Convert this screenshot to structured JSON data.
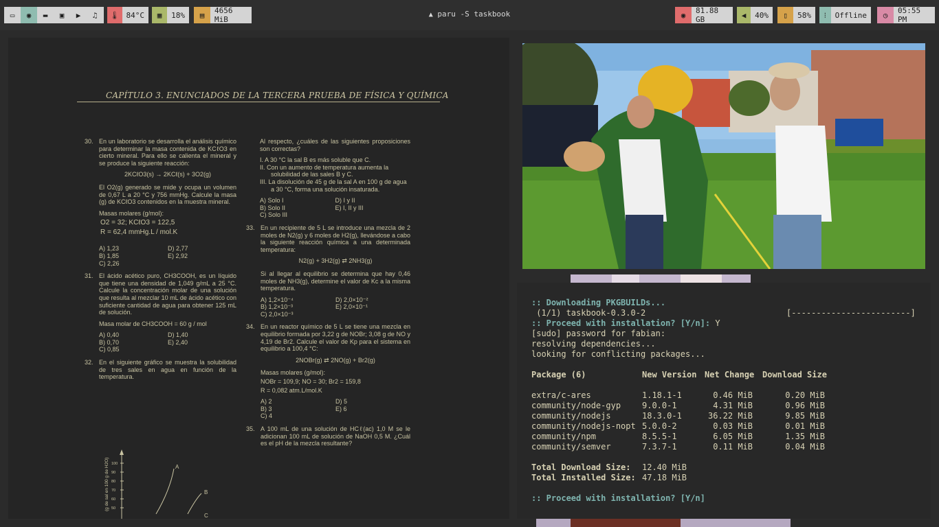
{
  "topbar": {
    "launcher_icons": [
      "terminal-icon",
      "browser-icon",
      "folder-icon",
      "monitor-icon",
      "youtube-icon",
      "music-icon"
    ],
    "temperature": "84°C",
    "cpu": "18%",
    "memory": "4656 MiB",
    "window_title": "paru -S taskbook",
    "disk": "81.88 GB",
    "volume": "40%",
    "battery": "58%",
    "network": "Offline",
    "clock": "05:55 PM",
    "colors": {
      "temp": "#e06c6c",
      "cpu": "#aab86a",
      "memory": "#d6a24a",
      "disk": "#e06c6c",
      "volume": "#aab86a",
      "battery": "#d6a24a",
      "network": "#8fbcb0",
      "clock": "#d98aa6"
    }
  },
  "pdf": {
    "chapter_header": "CAPÍTULO 3.  ENUNCIADOS DE LA TERCERA PRUEBA DE FÍSICA Y QUÍMICA",
    "q30": {
      "num": "30.",
      "text": "En un laboratorio se desarrolla el análisis químico para determinar la masa contenida de KCℓO3 en cierto mineral. Para ello se calienta el mineral y se produce la siguiente reacción:",
      "reaction": "2KCℓO3(s) → 2KCℓ(s) + 3O2(g)",
      "text2": "El O2(g) generado se mide y ocupa un volumen de 0,67 L a 20 °C y 756 mmHg. Calcule la masa (g) de KCℓO3 contenidos en la muestra mineral.",
      "molar_title": "Masas molares (g/mol):",
      "molar_values": "O2 = 32; KCℓO3 = 122,5",
      "r_value": "R = 62,4 mmHg.L / mol.K",
      "options": [
        "A) 1,23",
        "D) 2,77",
        "B) 1,85",
        "E) 2,92",
        "C) 2,26",
        ""
      ]
    },
    "q31": {
      "num": "31.",
      "text": "El ácido acético puro, CH3COOH, es un líquido que tiene una densidad de 1,049 g/mL a 25 °C. Calcule la concentración molar de una solución que resulta al mezclar 10 mL de ácido acético con suficiente cantidad de agua para obtener 125 mL de solución.",
      "molar": "Masa molar de CH3COOH = 60 g / mol",
      "options": [
        "A) 0,40",
        "D) 1,40",
        "B) 0,70",
        "E) 2,40",
        "C) 0,85",
        ""
      ]
    },
    "q32": {
      "num": "32.",
      "text": "En el siguiente gráfico se muestra la solubilidad de tres sales en agua en función de la temperatura.",
      "y_axis_label": "(g de sal en 100 g de H2O)",
      "y_ticks": [
        "100",
        "90",
        "80",
        "70",
        "60",
        "50"
      ],
      "curve_labels": [
        "A",
        "B",
        "C"
      ]
    },
    "q32_cont": {
      "text": "Al respecto, ¿cuáles de las siguientes proposiciones son correctas?",
      "statements": [
        "I.   A 30 °C la sal B es más soluble que C.",
        "II.  Con un aumento de temperatura aumenta la solubilidad de las sales B y C.",
        "III. La disolución de 45 g de la sal A en 100 g de agua a 30 °C, forma una solución insaturada."
      ],
      "options": [
        "A) Solo I",
        "D) I y II",
        "B) Solo II",
        "E) I, II y III",
        "C) Solo III",
        ""
      ]
    },
    "q33": {
      "num": "33.",
      "text": "En un recipiente de 5 L se introduce una mezcla de 2 moles de N2(g) y 6 moles de H2(g), llevándose a cabo la siguiente reacción química a una determinada temperatura:",
      "reaction": "N2(g) + 3H2(g) ⇄ 2NH3(g)",
      "text2": "Si al llegar al equilibrio se determina que hay 0,46 moles de NH3(g), determine el valor de Kc a la misma temperatura.",
      "options": [
        "A) 1,2×10⁻⁴",
        "D) 2,0×10⁻²",
        "B) 1,2×10⁻³",
        "E) 2,0×10⁻¹",
        "C) 2,0×10⁻³",
        ""
      ]
    },
    "q34": {
      "num": "34.",
      "text": "En un reactor químico de 5 L se tiene una mezcla en equilibrio formada por 3,22 g de NOBr; 3,08 g de NO y 4,19 de Br2. Calcule el valor de Kp para el sistema en equilibrio a 100,4 °C:",
      "reaction": "2NOBr(g) ⇄ 2NO(g) + Br2(g)",
      "molar_title": "Masas molares (g/mol):",
      "molar_values": "NOBr = 109,9; NO = 30; Br2 = 159,8",
      "r_value": "R = 0,082 atm.L/mol.K",
      "options": [
        "A) 2",
        "D) 5",
        "B) 3",
        "E) 6",
        "C) 4",
        ""
      ]
    },
    "q35": {
      "num": "35.",
      "text": "A 100 mL de una solución de HCℓ(ac) 1,0 M se le adicionan 100 mL de solución de NaOH 0,5 M. ¿Cuál es el pH de la mezcla resultante?"
    }
  },
  "terminal": {
    "line1": ":: Downloading PKGBUILDs...",
    "line2": " (1/1) taskbook-0.3.0-2",
    "progress": "[------------------------]",
    "line3_prompt": ":: Proceed with installation? [Y/n]:",
    "line3_answer": "Y",
    "line4": "[sudo] password for fabian:",
    "line5": "resolving dependencies...",
    "line6": "looking for conflicting packages...",
    "table_headers": [
      "Package (6)",
      "New Version",
      "Net Change",
      "Download Size"
    ],
    "packages": [
      [
        "extra/c-ares",
        "1.18.1-1",
        "0.46 MiB",
        "0.20 MiB"
      ],
      [
        "community/node-gyp",
        "9.0.0-1",
        "4.31 MiB",
        "0.96 MiB"
      ],
      [
        "community/nodejs",
        "18.3.0-1",
        "36.22 MiB",
        "9.85 MiB"
      ],
      [
        "community/nodejs-nopt",
        "5.0.0-2",
        "0.03 MiB",
        "0.01 MiB"
      ],
      [
        "community/npm",
        "8.5.5-1",
        "6.05 MiB",
        "1.35 MiB"
      ],
      [
        "community/semver",
        "7.3.7-1",
        "0.11 MiB",
        "0.04 MiB"
      ]
    ],
    "total_download_label": "Total Download Size:",
    "total_download_value": "12.40 MiB",
    "total_installed_label": "Total Installed Size:",
    "total_installed_value": "47.18 MiB",
    "final_prompt": ":: Proceed with installation? [Y/n]"
  }
}
